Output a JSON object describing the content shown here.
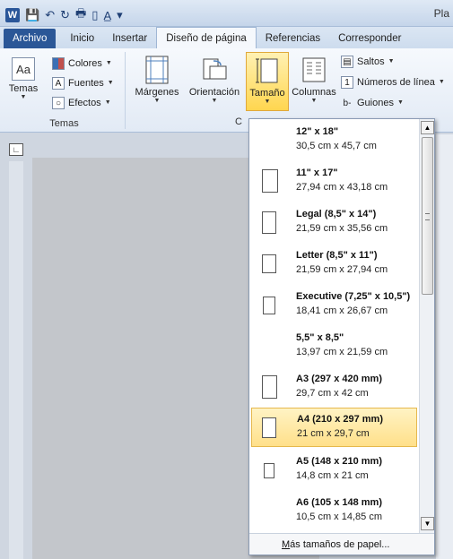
{
  "window": {
    "title_partial": "Pla"
  },
  "quick_access": {
    "icons": [
      "word-logo",
      "save-icon",
      "undo-icon",
      "redo-icon",
      "print-preview-icon",
      "new-document-icon",
      "text-format-icon",
      "customize-qat-icon"
    ],
    "word_letter": "W"
  },
  "tabs": [
    {
      "label": "Archivo",
      "type": "file"
    },
    {
      "label": "Inicio"
    },
    {
      "label": "Insertar"
    },
    {
      "label": "Diseño de página",
      "active": true
    },
    {
      "label": "Referencias"
    },
    {
      "label": "Corresponder"
    }
  ],
  "ribbon": {
    "temas_group": {
      "temas_label": "Temas",
      "colores_label": "Colores",
      "fuentes_label": "Fuentes",
      "efectos_label": "Efectos",
      "group_label": "Temas"
    },
    "config_group": {
      "margenes_label": "Márgenes",
      "orientacion_label": "Orientación",
      "tamano_label": "Tamaño",
      "columnas_label": "Columnas",
      "saltos_label": "Saltos",
      "numeros_label": "Números de línea",
      "guiones_label": "Guiones",
      "group_label_partial": "C"
    }
  },
  "size_menu": {
    "items": [
      {
        "name": "12\" x 18\"",
        "dims": "30,5 cm x 45,7 cm"
      },
      {
        "name": "11\" x 17\"",
        "dims": "27,94 cm x 43,18 cm"
      },
      {
        "name": "Legal (8,5\" x 14\")",
        "dims": "21,59 cm x 35,56 cm"
      },
      {
        "name": "Letter (8,5\" x 11\")",
        "dims": "21,59 cm x 27,94 cm"
      },
      {
        "name": "Executive (7,25\" x 10,5\")",
        "dims": "18,41 cm x 26,67 cm"
      },
      {
        "name": "5,5\" x 8,5\"",
        "dims": "13,97 cm x 21,59 cm"
      },
      {
        "name": "A3 (297 x 420 mm)",
        "dims": "29,7 cm x 42 cm"
      },
      {
        "name": "A4 (210 x 297 mm)",
        "dims": "21 cm x 29,7 cm",
        "selected": true
      },
      {
        "name": "A5 (148 x 210 mm)",
        "dims": "14,8 cm x 21 cm"
      },
      {
        "name": "A6 (105 x 148 mm)",
        "dims": "10,5 cm x 14,85 cm"
      }
    ],
    "more_label": "Más tamaños de papel..."
  }
}
